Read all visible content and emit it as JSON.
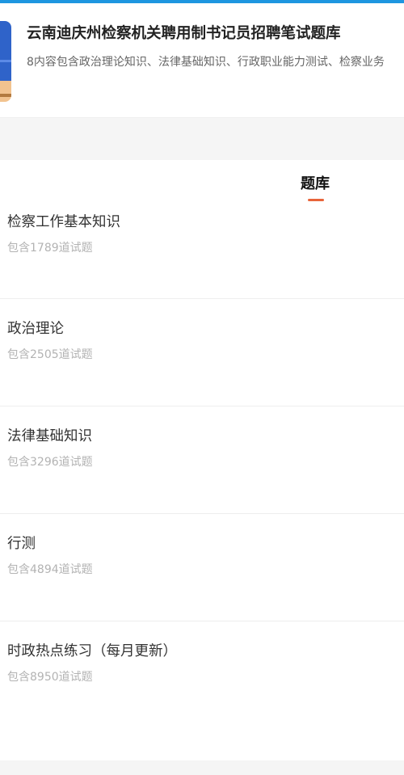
{
  "header": {
    "title": "云南迪庆州检察机关聘用制书记员招聘笔试题库",
    "description": "8内容包含政治理论知识、法律基础知识、行政职业能力测试、检察业务"
  },
  "tab": {
    "label": "题库"
  },
  "question_banks": [
    {
      "name": "检察工作基本知识",
      "count": "包含1789道试题"
    },
    {
      "name": "政治理论",
      "count": "包含2505道试题"
    },
    {
      "name": "法律基础知识",
      "count": "包含3296道试题"
    },
    {
      "name": "行测",
      "count": "包含4894道试题"
    },
    {
      "name": "时政热点练习（每月更新）",
      "count": "包含8950道试题"
    }
  ],
  "colors": {
    "accent_bar": "#1e96e0",
    "tab_underline": "#e8643a"
  }
}
